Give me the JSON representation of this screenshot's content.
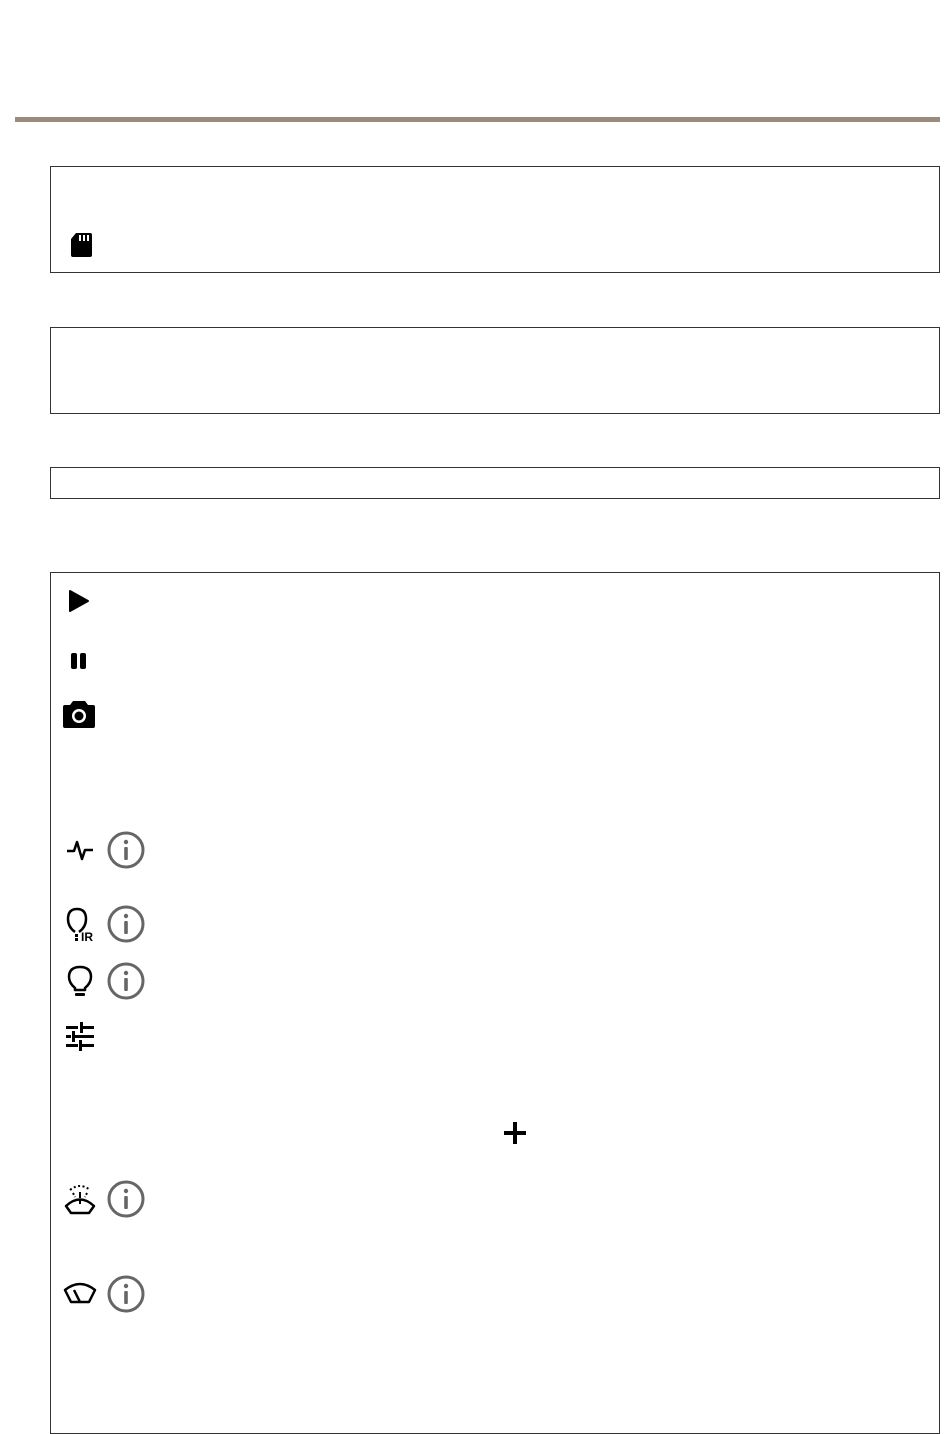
{
  "page": {
    "rule_color": "#9a8b7c",
    "icon_color": "#000000",
    "info_icon_color": "#666666"
  },
  "sections": [
    {
      "name": "storage-box",
      "icons": [
        "sd-card-icon"
      ]
    },
    {
      "name": "empty-box",
      "icons": []
    },
    {
      "name": "narrow-box",
      "icons": []
    },
    {
      "name": "controls-box",
      "icons": [
        "play-icon",
        "pause-icon",
        "camera-icon",
        "pulse-icon",
        "info-icon",
        "ir-light-icon",
        "info-icon",
        "light-bulb-icon",
        "info-icon",
        "sliders-icon",
        "plus-icon",
        "washer-icon",
        "info-icon",
        "wiper-icon",
        "info-icon"
      ]
    }
  ]
}
